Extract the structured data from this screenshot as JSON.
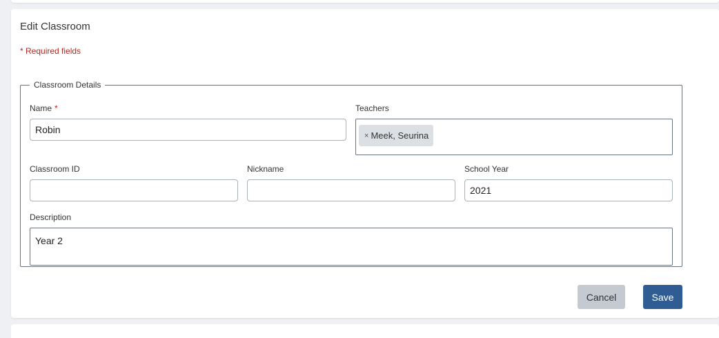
{
  "form": {
    "title": "Edit Classroom",
    "required_note": "* Required fields",
    "section_legend": "Classroom Details",
    "fields": {
      "name": {
        "label": "Name",
        "required_marker": "*",
        "value": "Robin"
      },
      "teachers": {
        "label": "Teachers",
        "chips": [
          {
            "remove_glyph": "×",
            "label": "Meek, Seurina"
          }
        ]
      },
      "classroom_id": {
        "label": "Classroom ID",
        "value": ""
      },
      "nickname": {
        "label": "Nickname",
        "value": ""
      },
      "school_year": {
        "label": "School Year",
        "value": "2021"
      },
      "description": {
        "label": "Description",
        "value": "Year 2"
      }
    },
    "buttons": {
      "cancel": "Cancel",
      "save": "Save"
    }
  },
  "colors": {
    "required": "#b3261e",
    "primary": "#2f5d93",
    "secondary_button": "#c5c9d0",
    "chip": "#dcdfe3"
  }
}
